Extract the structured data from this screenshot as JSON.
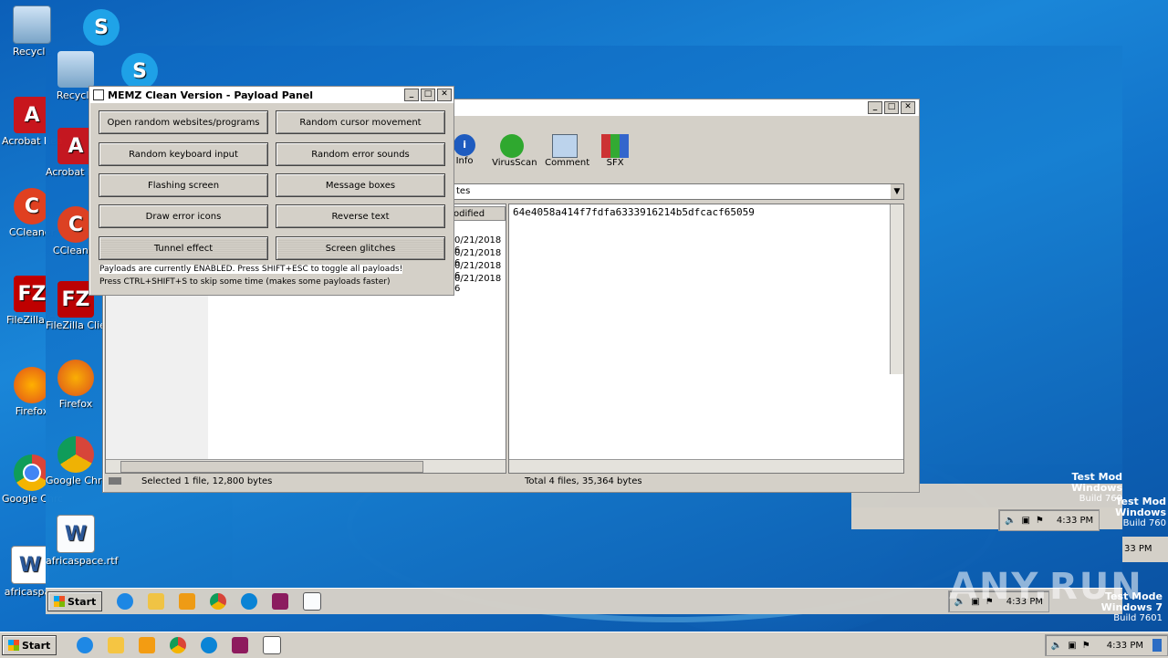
{
  "desktop": {
    "icons_left": [
      "Recycle",
      "Acrobat Reader D",
      "CCleaner",
      "FileZilla Cl",
      "Firefox",
      "Google Chrome",
      "africaspac"
    ],
    "icons_ghost": [
      "Recycle",
      "Acrobat Reader D",
      "CCleaner",
      "FileZilla Client",
      "Firefox",
      "Google Chrome",
      "africaspace.rtf"
    ]
  },
  "payload_panel": {
    "title": "MEMZ Clean Version - Payload Panel",
    "buttons": [
      "Open random websites/programs",
      "Random cursor movement",
      "Random keyboard input",
      "Random error sounds",
      "Flashing screen",
      "Message boxes",
      "Draw error icons",
      "Reverse text",
      "Tunnel effect",
      "Screen glitches"
    ],
    "status_line1": "Payloads are currently ENABLED. Press SHIFT+ESC to toggle all payloads!",
    "status_line2": "Press CTRL+SHIFT+S to skip some time (makes some payloads faster)"
  },
  "archive_window": {
    "toolbar": {
      "info": "Info",
      "virusscan": "VirusScan",
      "comment": "Comment",
      "sfx": "SFX"
    },
    "address_fragment": "tes",
    "column_modified": "odified",
    "dates": [
      "0/21/2018 6",
      "0/21/2018 6",
      "0/21/2018 6",
      "0/21/2018 6"
    ],
    "hash": "64e4058a414f7fdfa6333916214b5dfcacf65059",
    "status_left": "Selected 1 file, 12,800 bytes",
    "status_right": "Total 4 files, 35,364 bytes"
  },
  "taskbar": {
    "start": "Start",
    "time": "4:33 PM",
    "time_mid": "4:33 PM",
    "time_ghost": "4:33 PM",
    "time_edge": "33 PM"
  },
  "watermark": {
    "line1": "Test Mode",
    "line2": "Windows 7",
    "line3": "Build 7601",
    "t1": "Test Mod",
    "t2": "Windows",
    "t3": "Build 760",
    "anyrun": "ANY.RUN"
  },
  "colors": {
    "desktop": "#1a86d8",
    "window_face": "#d4d0c8"
  }
}
